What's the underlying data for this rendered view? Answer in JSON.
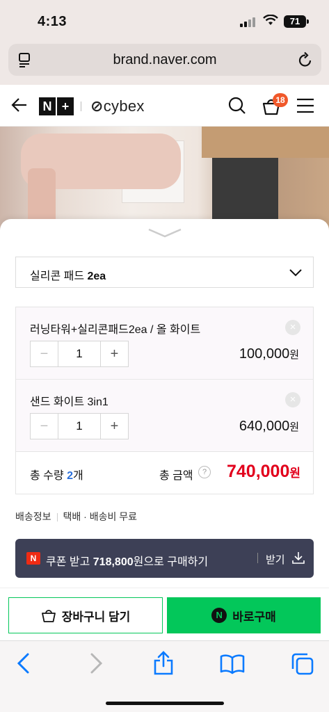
{
  "status": {
    "time": "4:13",
    "battery": "71"
  },
  "browser": {
    "url": "brand.naver.com"
  },
  "header": {
    "nplus": [
      "N",
      "+"
    ],
    "brand": "cybex",
    "cart_count": "18"
  },
  "sheet": {
    "option": {
      "label_prefix": "실리콘 패드 ",
      "label_bold": "2ea"
    },
    "items": [
      {
        "name": "러닝타워+실리콘패드2ea / 올 화이트",
        "qty": "1",
        "price": "100,000",
        "currency": "원",
        "remove": "×"
      },
      {
        "name": "샌드 화이트 3in1",
        "qty": "1",
        "price": "640,000",
        "currency": "원",
        "remove": "×"
      }
    ],
    "stepper": {
      "minus": "−",
      "plus": "+"
    },
    "total": {
      "qty_label": "총 수량 ",
      "qty_value": "2",
      "qty_unit": "개",
      "amount_label": "총 금액",
      "help": "?",
      "amount": "740,000",
      "currency": "원"
    },
    "shipping": {
      "label": "배송정보",
      "value": "택배 · 배송비 무료"
    },
    "coupon": {
      "badge": "N",
      "prefix": "쿠폰 받고 ",
      "amount": "718,800",
      "suffix": "원으로 구매하기",
      "get_label": "받기"
    }
  },
  "actions": {
    "cart_label": "장바구니 담기",
    "buy_badge": "N",
    "buy_label": "바로구매"
  },
  "colors": {
    "naver_green": "#03c75a",
    "price_red": "#e2001c",
    "coupon_bg": "#3d4056",
    "cart_badge": "#f0582a",
    "ios_blue": "#0a7aff"
  }
}
